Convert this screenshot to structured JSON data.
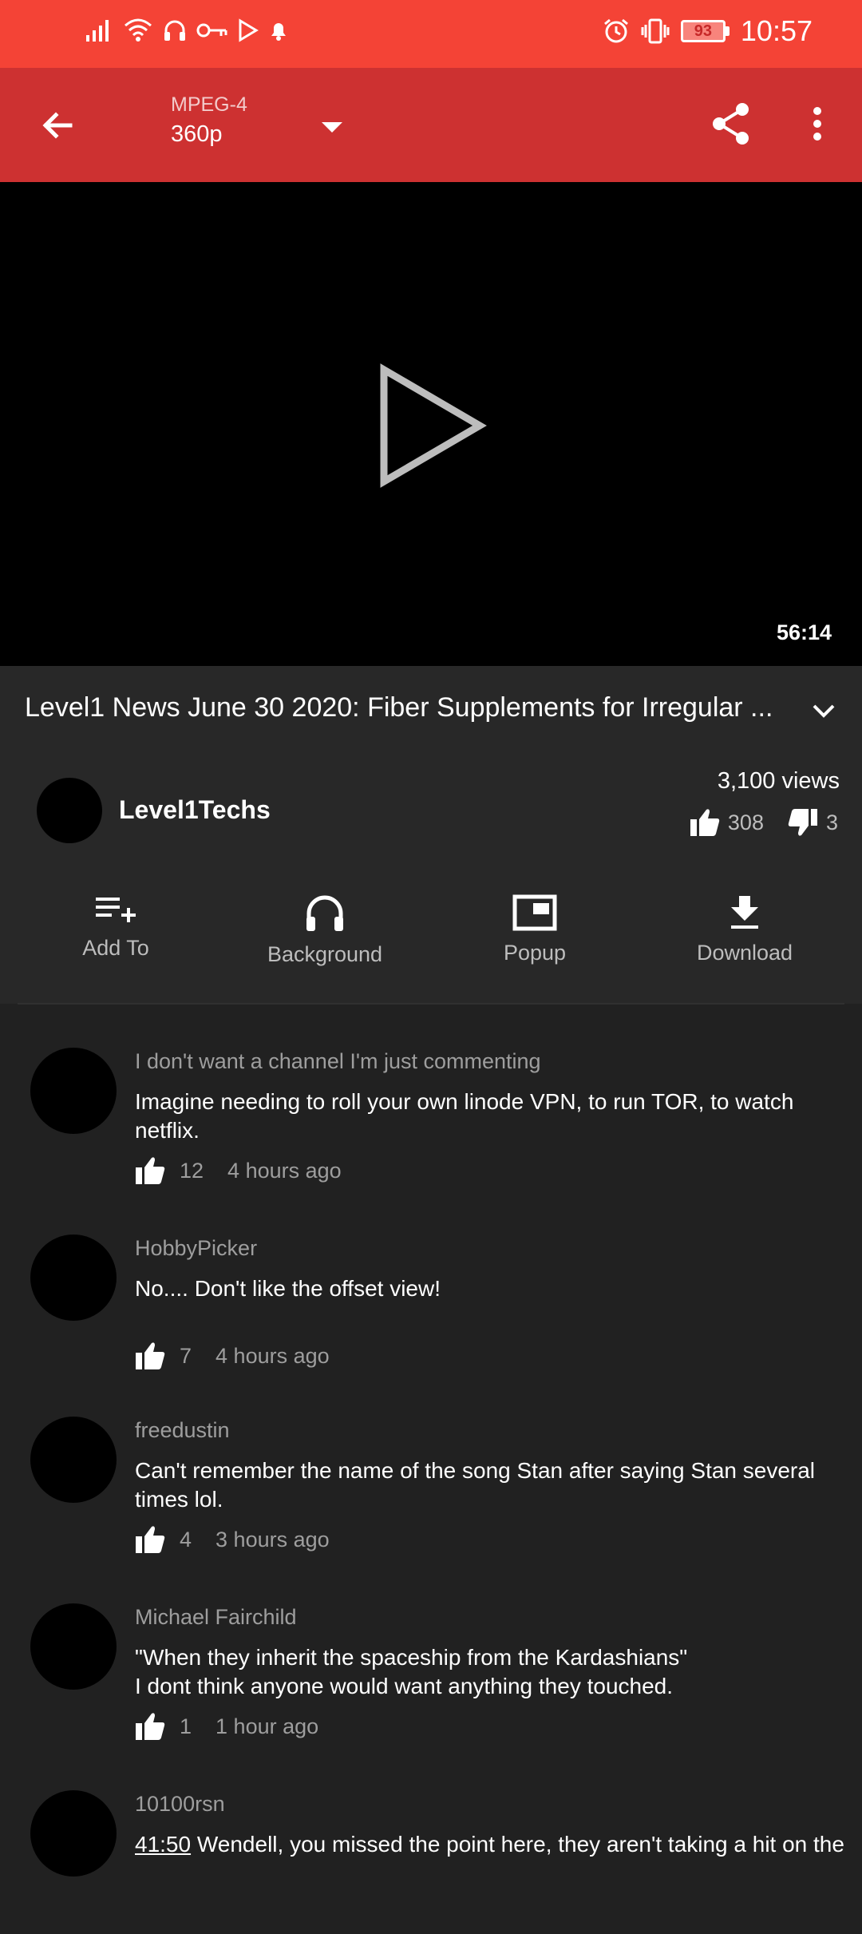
{
  "status_bar": {
    "battery": "93",
    "time": "10:57"
  },
  "toolbar": {
    "format": "MPEG-4",
    "quality": "360p"
  },
  "video": {
    "duration": "56:14"
  },
  "details": {
    "title": "Level1 News June 30 2020: Fiber Supplements for Irregular ...",
    "channel": "Level1Techs",
    "views": "3,100 views",
    "likes": "308",
    "dislikes": "3"
  },
  "actions": [
    {
      "label": "Add To",
      "icon": "playlist-add-icon"
    },
    {
      "label": "Background",
      "icon": "headphones-icon"
    },
    {
      "label": "Popup",
      "icon": "picture-in-picture-icon"
    },
    {
      "label": "Download",
      "icon": "download-icon"
    }
  ],
  "comments": [
    {
      "author": "I don't want a channel I'm just commenting",
      "text": "Imagine needing to roll your own linode VPN, to run TOR, to watch netflix.",
      "likes": "12",
      "time": "4 hours ago"
    },
    {
      "author": "HobbyPicker",
      "text": "No.... Don't like the offset view!",
      "likes": "7",
      "time": "4 hours ago"
    },
    {
      "author": "freedustin",
      "text": "Can't remember the name of the song Stan after saying Stan several times lol.",
      "likes": "4",
      "time": "3 hours ago"
    },
    {
      "author": "Michael Fairchild",
      "text": "\"When they inherit the spaceship from the Kardashians\"\nI dont think anyone would want anything they touched.",
      "likes": "1",
      "time": "1 hour ago"
    },
    {
      "author": "10100rsn",
      "timestamp": "41:50",
      "text": " Wendell, you missed the point here, they aren't taking a hit on the"
    }
  ]
}
